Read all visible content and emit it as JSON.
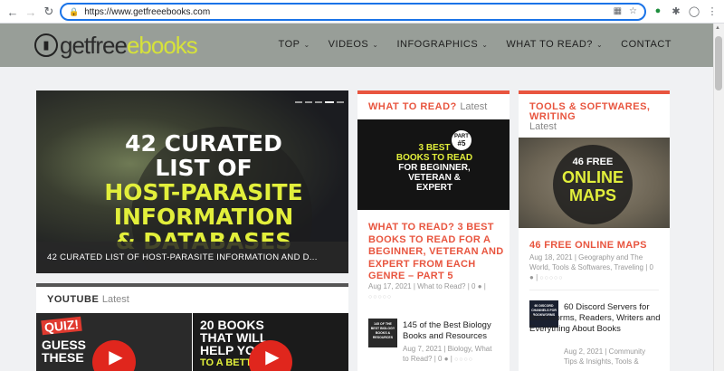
{
  "browser": {
    "url": "https://www.getfreeebooks.com"
  },
  "site": {
    "logo_part1": "getfree",
    "logo_part2": "ebooks",
    "menu": [
      {
        "label": "TOP"
      },
      {
        "label": "VIDEOS"
      },
      {
        "label": "INFOGRAPHICS"
      },
      {
        "label": "WHAT TO READ?"
      },
      {
        "label": "CONTACT"
      }
    ]
  },
  "hero": {
    "line1": "42 CURATED",
    "line2": "LIST OF",
    "line3": "HOST-PARASITE",
    "line4": "INFORMATION",
    "line5": "& DATABASES",
    "caption": "42 CURATED LIST OF HOST-PARASITE INFORMATION AND D..."
  },
  "youtube": {
    "title": "YOUTUBE",
    "latest": "Latest",
    "thumb1_text1": "QUIZ!",
    "thumb1_text2": "GUESS",
    "thumb1_text3": "THESE",
    "thumb2_text1": "20 BOOKS",
    "thumb2_text2": "THAT WILL",
    "thumb2_text3": "HELP YOU",
    "thumb2_text4": "TO A BETT"
  },
  "what_to_read": {
    "title": "WHAT TO READ?",
    "latest": "Latest",
    "thumb_badge_line1": "PART",
    "thumb_badge_line2": "#5",
    "thumb_l1": "3 BEST",
    "thumb_l2": "BOOKS TO READ",
    "thumb_l3": "FOR BEGINNER,",
    "thumb_l4": "VETERAN &",
    "thumb_l5": "EXPERT",
    "post_title": "WHAT TO READ? 3 BEST BOOKS TO READ FOR A BEGINNER, VETERAN AND EXPERT FROM EACH GENRE – PART 5",
    "post_meta": "Aug 17, 2021 | What to Read? | 0",
    "small_thumb": "145 OF THE BEST BIOLOGY BOOKS & RESOURCES",
    "small_title": "145 of the Best Biology Books and Resources",
    "small_meta1": "Aug 7, 2021 | Biology, What",
    "small_meta2": "to Read? | 0"
  },
  "tools": {
    "title": "TOOLS & SOFTWARES, WRITING",
    "latest": "Latest",
    "thumb_l1": "46 FREE",
    "thumb_l2": "ONLINE",
    "thumb_l3": "MAPS",
    "post_title": "46 FREE ONLINE MAPS",
    "post_meta1": "Aug 18, 2021 | Geography and The",
    "post_meta2": "World, Tools & Softwares, Traveling | 0",
    "small_thumb": "60 DISCORD CHANNELS FOR BOOKWORMS",
    "small_title": "60 Discord Servers for Bookworms, Readers, Writers and Everything About Books",
    "small_meta1": "Aug 2, 2021 | Community",
    "small_meta2": "Tips & Insights, Tools &"
  },
  "colors": {
    "accent": "#e8553f",
    "header_bg": "#989e98",
    "logo_green": "#d6e23a"
  }
}
